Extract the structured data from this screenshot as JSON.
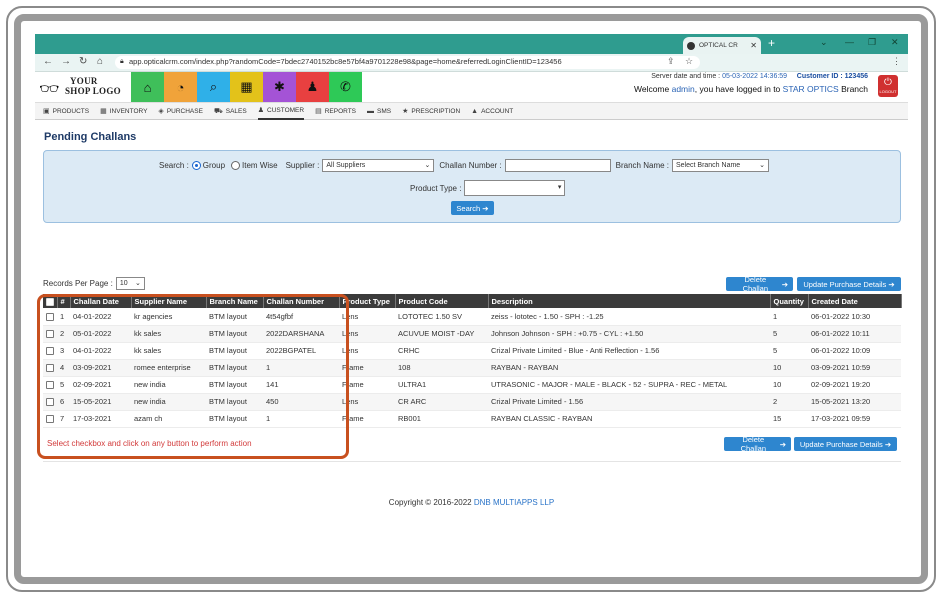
{
  "browser": {
    "tab_title": "OPTICAL CR",
    "new_tab": "+",
    "url": "app.opticalcrm.com/index.php?randomCode=7bdec2740152bc8e57bf4a9701228e98&page=home&referredLoginClientID=123456"
  },
  "header": {
    "logo_line1": "YOUR",
    "logo_line2": "SHOP LOGO",
    "server_label": "Server date and time : ",
    "server_value": "05-03-2022 14:36:59",
    "customer_label": "Customer ID : ",
    "customer_value": "123456",
    "welcome_prefix": "Welcome ",
    "welcome_user": "admin",
    "welcome_mid": ", you have logged in to ",
    "welcome_branch": "STAR OPTICS",
    "welcome_suffix": " Branch",
    "logout_label": "LOGOUT",
    "color_tabs": [
      {
        "icon": "home-icon",
        "glyph": "⌂",
        "color": "#3fbf5a"
      },
      {
        "icon": "dashboard-icon",
        "glyph": "◔",
        "color": "#f0a33a"
      },
      {
        "icon": "search-icon",
        "glyph": "⌕",
        "color": "#2fb0e8"
      },
      {
        "icon": "grid-icon",
        "glyph": "▦",
        "color": "#e3c21a"
      },
      {
        "icon": "settings-icon",
        "glyph": "✱",
        "color": "#a453d6"
      },
      {
        "icon": "user-icon",
        "glyph": "♟",
        "color": "#e84040"
      },
      {
        "icon": "whatsapp-icon",
        "glyph": "✆",
        "color": "#2ec957"
      }
    ]
  },
  "nav": {
    "items": [
      {
        "label": "PRODUCTS",
        "icon": "cube-icon",
        "glyph": "▣"
      },
      {
        "label": "INVENTORY",
        "icon": "grid-icon",
        "glyph": "▦"
      },
      {
        "label": "PURCHASE",
        "icon": "tag-icon",
        "glyph": "◈"
      },
      {
        "label": "SALES",
        "icon": "cart-icon",
        "glyph": "⛟"
      },
      {
        "label": "CUSTOMER",
        "icon": "user-icon",
        "glyph": "♟"
      },
      {
        "label": "REPORTS",
        "icon": "file-icon",
        "glyph": "▤"
      },
      {
        "label": "SMS",
        "icon": "chat-icon",
        "glyph": "▬"
      },
      {
        "label": "PRESCRIPTION",
        "icon": "star-icon",
        "glyph": "★"
      },
      {
        "label": "ACCOUNT",
        "icon": "lock-icon",
        "glyph": "▲"
      }
    ],
    "active": "CUSTOMER"
  },
  "page": {
    "title": "Pending Challans"
  },
  "search": {
    "label": "Search :",
    "radio_group": "Group",
    "radio_item": "Item Wise",
    "supplier_label": "Supplier :",
    "supplier_value": "All Suppliers",
    "challan_label": "Challan Number :",
    "challan_value": "",
    "branch_label": "Branch Name :",
    "branch_value": "Select Branch Name",
    "product_type_label": "Product Type :",
    "product_type_value": "",
    "search_button": "Search"
  },
  "toolbar": {
    "records_label": "Records Per Page :",
    "records_value": "10",
    "delete_label": "Delete Challan",
    "update_label": "Update Purchase Details"
  },
  "table": {
    "headers": [
      "#",
      "Challan Date",
      "Supplier Name",
      "Branch Name",
      "Challan Number",
      "Product Type",
      "Product Code",
      "Description",
      "Quantity",
      "Created Date"
    ],
    "rows": [
      [
        "1",
        "04-01-2022",
        "kr agencies",
        "BTM layout",
        "4t54gfbf",
        "Lens",
        "LOTOTEC 1.50 SV",
        "zeiss - lototec - 1.50 - SPH : -1.25",
        "1",
        "06-01-2022 10:30"
      ],
      [
        "2",
        "05-01-2022",
        "kk sales",
        "BTM layout",
        "2022DARSHANA",
        "Lens",
        "ACUVUE MOIST -DAY",
        "Johnson Johnson - SPH : +0.75 - CYL : +1.50",
        "5",
        "06-01-2022 10:11"
      ],
      [
        "3",
        "04-01-2022",
        "kk sales",
        "BTM layout",
        "2022BGPATEL",
        "Lens",
        "CRHC",
        "Crizal Private Limited - Blue - Anti Reflection - 1.56",
        "5",
        "06-01-2022 10:09"
      ],
      [
        "4",
        "03-09-2021",
        "romee enterprise",
        "BTM layout",
        "1",
        "Frame",
        "108",
        "RAYBAN - RAYBAN",
        "10",
        "03-09-2021 10:59"
      ],
      [
        "5",
        "02-09-2021",
        "new india",
        "BTM layout",
        "141",
        "Frame",
        "ULTRA1",
        "UTRASONIC - MAJOR - MALE - BLACK - 52 - SUPRA - REC - METAL",
        "10",
        "02-09-2021 19:20"
      ],
      [
        "6",
        "15-05-2021",
        "new india",
        "BTM layout",
        "450",
        "Lens",
        "CR ARC",
        "Crizal Private Limited - 1.56",
        "2",
        "15-05-2021 13:20"
      ],
      [
        "7",
        "17-03-2021",
        "azam ch",
        "BTM layout",
        "1",
        "Frame",
        "RB001",
        "RAYBAN CLASSIC - RAYBAN",
        "15",
        "17-03-2021 09:59"
      ]
    ],
    "hint": "Select checkbox and click on any button to perform action"
  },
  "footer": {
    "copyright": "Copyright © 2016-2022 ",
    "company": "DNB MULTIAPPS LLP"
  },
  "colors": {
    "browser_chrome": "#2f9c8f",
    "primary_button": "#2e86cf",
    "table_header": "#3b3b3b",
    "highlight_border": "#c8501f",
    "hint_text": "#d23a3a"
  }
}
